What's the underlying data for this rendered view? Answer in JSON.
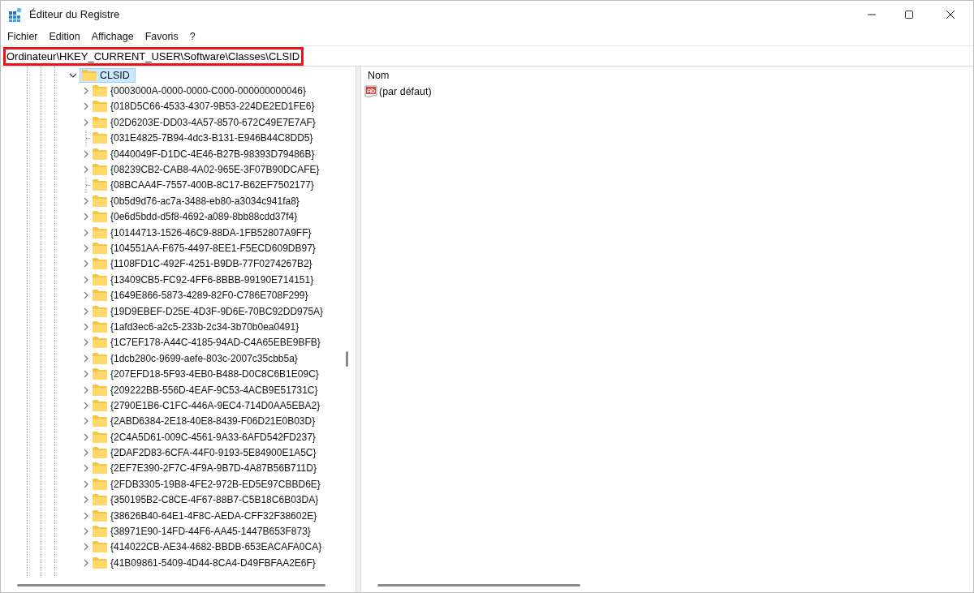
{
  "window": {
    "title": "Éditeur du Registre"
  },
  "menu": [
    "Fichier",
    "Edition",
    "Affichage",
    "Favoris",
    "?"
  ],
  "address": {
    "value": "Ordinateur\\HKEY_CURRENT_USER\\Software\\Classes\\CLSID",
    "highlighted": true
  },
  "tree": {
    "label": "CLSID",
    "expanded": true,
    "selected": true,
    "children": [
      {
        "label": "{0003000A-0000-0000-C000-000000000046}",
        "expandable": true
      },
      {
        "label": "{018D5C66-4533-4307-9B53-224DE2ED1FE6}",
        "expandable": true
      },
      {
        "label": "{02D6203E-DD03-4A57-8570-672C49E7E7AF}",
        "expandable": true
      },
      {
        "label": "{031E4825-7B94-4dc3-B131-E946B44C8DD5}",
        "expandable": false
      },
      {
        "label": "{0440049F-D1DC-4E46-B27B-98393D79486B}",
        "expandable": true
      },
      {
        "label": "{08239CB2-CAB8-4A02-965E-3F07B90DCAFE}",
        "expandable": true
      },
      {
        "label": "{08BCAA4F-7557-400B-8C17-B62EF7502177}",
        "expandable": false
      },
      {
        "label": "{0b5d9d76-ac7a-3488-eb80-a3034c941fa8}",
        "expandable": true
      },
      {
        "label": "{0e6d5bdd-d5f8-4692-a089-8bb88cdd37f4}",
        "expandable": true
      },
      {
        "label": "{10144713-1526-46C9-88DA-1FB52807A9FF}",
        "expandable": true
      },
      {
        "label": "{104551AA-F675-4497-8EE1-F5ECD609DB97}",
        "expandable": true
      },
      {
        "label": "{1108FD1C-492F-4251-B9DB-77F0274267B2}",
        "expandable": true
      },
      {
        "label": "{13409CB5-FC92-4FF6-8BBB-99190E714151}",
        "expandable": true
      },
      {
        "label": "{1649E866-5873-4289-82F0-C786E708F299}",
        "expandable": true
      },
      {
        "label": "{19D9EBEF-D25E-4D3F-9D6E-70BC92DD975A}",
        "expandable": true
      },
      {
        "label": "{1afd3ec6-a2c5-233b-2c34-3b70b0ea0491}",
        "expandable": true
      },
      {
        "label": "{1C7EF178-A44C-4185-94AD-C4A65EBE9BFB}",
        "expandable": true
      },
      {
        "label": "{1dcb280c-9699-aefe-803c-2007c35cbb5a}",
        "expandable": true
      },
      {
        "label": "{207EFD18-5F93-4EB0-B488-D0C8C6B1E09C}",
        "expandable": true
      },
      {
        "label": "{209222BB-556D-4EAF-9C53-4ACB9E51731C}",
        "expandable": true
      },
      {
        "label": "{2790E1B6-C1FC-446A-9EC4-714D0AA5EBA2}",
        "expandable": true
      },
      {
        "label": "{2ABD6384-2E18-40E8-8439-F06D21E0B03D}",
        "expandable": true
      },
      {
        "label": "{2C4A5D61-009C-4561-9A33-6AFD542FD237}",
        "expandable": true
      },
      {
        "label": "{2DAF2D83-6CFA-44F0-9193-5E84900E1A5C}",
        "expandable": true
      },
      {
        "label": "{2EF7E390-2F7C-4F9A-9B7D-4A87B56B711D}",
        "expandable": true
      },
      {
        "label": "{2FDB3305-19B8-4FE2-972B-ED5E97CBBD6E}",
        "expandable": true
      },
      {
        "label": "{350195B2-C8CE-4F67-88B7-C5B18C6B03DA}",
        "expandable": true
      },
      {
        "label": "{38626B40-64E1-4F8C-AEDA-CFF32F38602E}",
        "expandable": true
      },
      {
        "label": "{38971E90-14FD-44F6-AA45-1447B653F873}",
        "expandable": true
      },
      {
        "label": "{414022CB-AE34-4682-BBDB-653EACAFA0CA}",
        "expandable": true
      },
      {
        "label": "{41B09861-5409-4D44-8CA4-D49FBFAA2E6F}",
        "expandable": true
      }
    ]
  },
  "values": {
    "columns": [
      "Nom"
    ],
    "rows": [
      {
        "name": "(par défaut)"
      }
    ]
  }
}
